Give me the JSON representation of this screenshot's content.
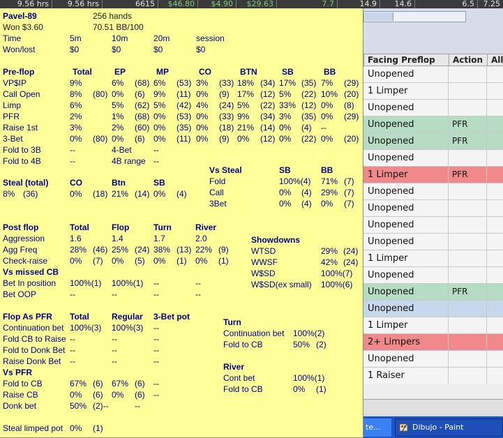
{
  "topbar": {
    "cells": [
      "9.56 hrs",
      "9.56 hrs",
      "6615",
      "$46.80",
      "$4.90",
      "$29.63",
      "7.7",
      "14.9",
      "14.6",
      "6.5",
      "7.25"
    ]
  },
  "grid": {
    "headers": [
      "Facing Preflop",
      "Action",
      "All-"
    ],
    "rows": [
      {
        "facing": "Unopened",
        "action": "",
        "style": "wh"
      },
      {
        "facing": "1 Limper",
        "action": "",
        "style": "wh"
      },
      {
        "facing": "Unopened",
        "action": "",
        "style": "wh"
      },
      {
        "facing": "Unopened",
        "action": "PFR",
        "style": "gr"
      },
      {
        "facing": "Unopened",
        "action": "PFR",
        "style": "gr"
      },
      {
        "facing": "Unopened",
        "action": "",
        "style": "wh"
      },
      {
        "facing": "1 Limper",
        "action": "PFR",
        "style": "rd"
      },
      {
        "facing": "Unopened",
        "action": "",
        "style": "wh"
      },
      {
        "facing": "Unopened",
        "action": "",
        "style": "wh"
      },
      {
        "facing": "Unopened",
        "action": "",
        "style": "wh"
      },
      {
        "facing": "Unopened",
        "action": "",
        "style": "wh"
      },
      {
        "facing": "1 Limper",
        "action": "",
        "style": "wh"
      },
      {
        "facing": "Unopened",
        "action": "",
        "style": "wh"
      },
      {
        "facing": "Unopened",
        "action": "PFR",
        "style": "gr"
      },
      {
        "facing": "Unopened",
        "action": "",
        "style": "bl"
      },
      {
        "facing": "1 Limper",
        "action": "",
        "style": "wh"
      },
      {
        "facing": "2+ Limpers",
        "action": "",
        "style": "rd"
      },
      {
        "facing": "Unopened",
        "action": "",
        "style": "wh"
      },
      {
        "facing": "1 Raiser",
        "action": "",
        "style": "wh"
      }
    ]
  },
  "taskbar": {
    "task1": "te...",
    "task2": "Dibujo - Paint"
  },
  "hud": {
    "player": "Pavel-89",
    "hands": "256 hands",
    "won": "Won  $3.60",
    "bb100": "70.51 BB/100",
    "time_label": "Time",
    "t5": "5m",
    "t10": "10m",
    "t20": "20m",
    "tsession": "session",
    "wonlost_label": "Won/lost",
    "w5": "$0",
    "w10": "$0",
    "w20": "$0",
    "wsession": "$0",
    "preflop": {
      "headers": [
        "Pre-flop",
        "Total",
        "EP",
        "MP",
        "CO",
        "BTN",
        "SB",
        "BB"
      ],
      "rows": [
        [
          "VP$IP",
          "9%",
          "",
          "6%",
          "(68)",
          "6%",
          "(53)",
          "3%",
          "(33)",
          "18%",
          "(34)",
          "17%",
          "(35)",
          "7%",
          "(29)"
        ],
        [
          "Call Open",
          "8%",
          "(80)",
          "0%",
          "(6)",
          "9%",
          "(11)",
          "0%",
          "(9)",
          "17%",
          "(12)",
          "5%",
          "(22)",
          "10%",
          "(20)"
        ],
        [
          "Limp",
          "6%",
          "",
          "5%",
          "(62)",
          "5%",
          "(42)",
          "4%",
          "(24)",
          "5%",
          "(22)",
          "33%",
          "(12)",
          "0%",
          "(8)"
        ],
        [
          "PFR",
          "2%",
          "",
          "1%",
          "(68)",
          "0%",
          "(53)",
          "0%",
          "(33)",
          "9%",
          "(34)",
          "3%",
          "(35)",
          "0%",
          "(29)"
        ],
        [
          "Raise 1st",
          "3%",
          "",
          "2%",
          "(60)",
          "0%",
          "(35)",
          "0%",
          "(18)",
          "21%",
          "(14)",
          "0%",
          "(4)",
          "--",
          ""
        ],
        [
          "3-Bet",
          "0%",
          "(80)",
          "0%",
          "(6)",
          "0%",
          "(11)",
          "0%",
          "(9)",
          "0%",
          "(12)",
          "0%",
          "(22)",
          "0%",
          "(20)"
        ]
      ],
      "fold3b_label": "Fold to 3B",
      "fold3b_val": "--",
      "fourbet_label": "4-Bet",
      "fourbet_val": "--",
      "fold4b_label": "Fold to 4B",
      "fold4b_val": "--",
      "fourbrange_label": "4B range",
      "fourbrange_val": "--"
    },
    "vssteal": {
      "title": "Vs Steal",
      "sb": "SB",
      "bb": "BB",
      "rows": [
        [
          "Fold",
          "100%(4)",
          "71%",
          "(7)"
        ],
        [
          "Call",
          "0%",
          "(4)",
          "29%",
          "(7)"
        ],
        [
          "3Bet",
          "0%",
          "(4)",
          "0%",
          "(7)"
        ]
      ]
    },
    "steal": {
      "title": "Steal (total)",
      "co": "CO",
      "btn": "Btn",
      "sb": "SB",
      "vals": [
        "8%",
        "(36)",
        "0%",
        "(18)",
        "21%",
        "(14)",
        "0%",
        "(4)"
      ]
    },
    "postflop": {
      "headers": [
        "Post flop",
        "Total",
        "Flop",
        "Turn",
        "River"
      ],
      "rows": [
        [
          "Aggression",
          "1.6",
          "",
          "1.4",
          "",
          "1.7",
          "",
          "2.0",
          ""
        ],
        [
          "Agg Freq",
          "28%",
          "(46)",
          "25%",
          "(24)",
          "38%",
          "(13)",
          "22%",
          "(9)"
        ],
        [
          "Check-raise",
          "0%",
          "(7)",
          "0%",
          "(5)",
          "0%",
          "(1)",
          "0%",
          "(1)"
        ]
      ]
    },
    "showdowns": {
      "title": "Showdowns",
      "rows": [
        [
          "WTSD",
          "29%",
          "(24)"
        ],
        [
          "WWSF",
          "42%",
          "(24)"
        ],
        [
          "W$SD",
          "100%(7)",
          ""
        ],
        [
          "W$SD(ex small)",
          "100%(6)",
          ""
        ]
      ]
    },
    "missedcb": {
      "title": "Vs missed CB",
      "rows": [
        [
          "Bet In position",
          "100%(1)",
          "100%(1)",
          "--",
          "--"
        ],
        [
          "Bet OOP",
          "--",
          "--",
          "--",
          "--"
        ]
      ]
    },
    "flopaspfr": {
      "headers": [
        "Flop As PFR",
        "Total",
        "Regular",
        "3-Bet pot"
      ],
      "rows": [
        [
          "Continuation bet",
          "100%(3)",
          "100%(3)",
          "--"
        ],
        [
          "Fold CB to Raise",
          "--",
          "--",
          "--"
        ],
        [
          "Fold to Donk Bet",
          "--",
          "--",
          "--"
        ],
        [
          "Raise Donk Bet",
          "--",
          "--",
          "--"
        ]
      ]
    },
    "turn": {
      "title": "Turn",
      "rows": [
        [
          "Continuation bet",
          "100%(2)",
          ""
        ],
        [
          "Fold to CB",
          "50%",
          "(2)"
        ]
      ]
    },
    "vspfr": {
      "title": "Vs PFR",
      "rows": [
        [
          "Fold to CB",
          "67%",
          "(6)",
          "67%",
          "(6)",
          "--"
        ],
        [
          "Raise CB",
          "0%",
          "(6)",
          "0%",
          "(6)",
          "--"
        ],
        [
          "Donk bet",
          "50%",
          "(2)--",
          "",
          "",
          "--"
        ]
      ]
    },
    "river": {
      "title": "River",
      "rows": [
        [
          "Cont bet",
          "100%(1)",
          ""
        ],
        [
          "Fold to CB",
          "0%",
          "(1)"
        ]
      ]
    },
    "stealLimped": {
      "label": "Steal limped pot",
      "v1": "0%",
      "v2": "(1)"
    }
  }
}
